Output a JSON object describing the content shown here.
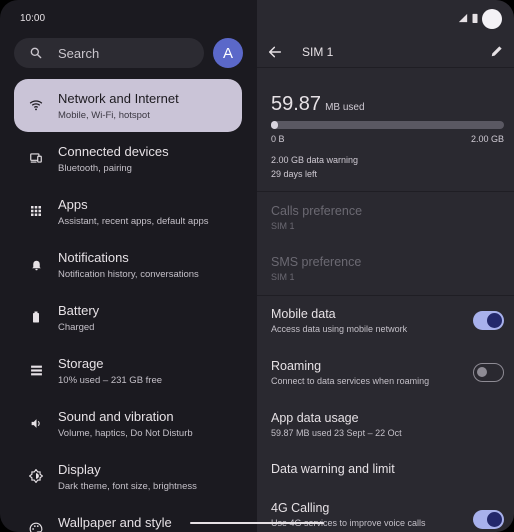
{
  "status_bar": {
    "time": "10:00"
  },
  "left": {
    "search_label": "Search",
    "avatar_letter": "A",
    "menu": [
      {
        "title": "Network and Internet",
        "sub": "Mobile, Wi-Fi, hotspot",
        "icon": "wifi-icon"
      },
      {
        "title": "Connected devices",
        "sub": "Bluetooth, pairing",
        "icon": "devices-icon"
      },
      {
        "title": "Apps",
        "sub": "Assistant, recent apps, default apps",
        "icon": "apps-grid-icon"
      },
      {
        "title": "Notifications",
        "sub": "Notification history, conversations",
        "icon": "bell-icon"
      },
      {
        "title": "Battery",
        "sub": "Charged",
        "icon": "battery-icon"
      },
      {
        "title": "Storage",
        "sub": "10% used – 231 GB free",
        "icon": "storage-icon"
      },
      {
        "title": "Sound and vibration",
        "sub": "Volume, haptics, Do Not Disturb",
        "icon": "volume-icon"
      },
      {
        "title": "Display",
        "sub": "Dark theme, font size, brightness",
        "icon": "brightness-icon"
      },
      {
        "title": "Wallpaper and style",
        "sub": "",
        "icon": "palette-icon"
      }
    ]
  },
  "right": {
    "title": "SIM 1",
    "usage_value": "59.87",
    "usage_unit": "MB used",
    "usage_fraction": 0.03,
    "bar_min": "0 B",
    "bar_max": "2.00 GB",
    "warning": "2.00 GB data warning",
    "days_left": "29 days left",
    "calls_pref": {
      "title": "Calls preference",
      "sub": "SIM 1"
    },
    "sms_pref": {
      "title": "SMS preference",
      "sub": "SIM 1"
    },
    "mobile_data": {
      "title": "Mobile data",
      "sub": "Access data using mobile network",
      "on": true
    },
    "roaming": {
      "title": "Roaming",
      "sub": "Connect to data services when roaming",
      "on": false
    },
    "app_usage": {
      "title": "App data usage",
      "sub": "59.87 MB used 23 Sept – 22 Oct"
    },
    "warn_limit": {
      "title": "Data warning and limit"
    },
    "calling_4g": {
      "title": "4G Calling",
      "sub": "Use 4G services to improve voice calls",
      "on": true
    }
  },
  "colors": {
    "left_bg": "#1b1a20",
    "right_bg": "#2a2930",
    "active_item": "#cac4d7",
    "toggle_on": "#a8b1ec",
    "avatar": "#5b68c9"
  }
}
